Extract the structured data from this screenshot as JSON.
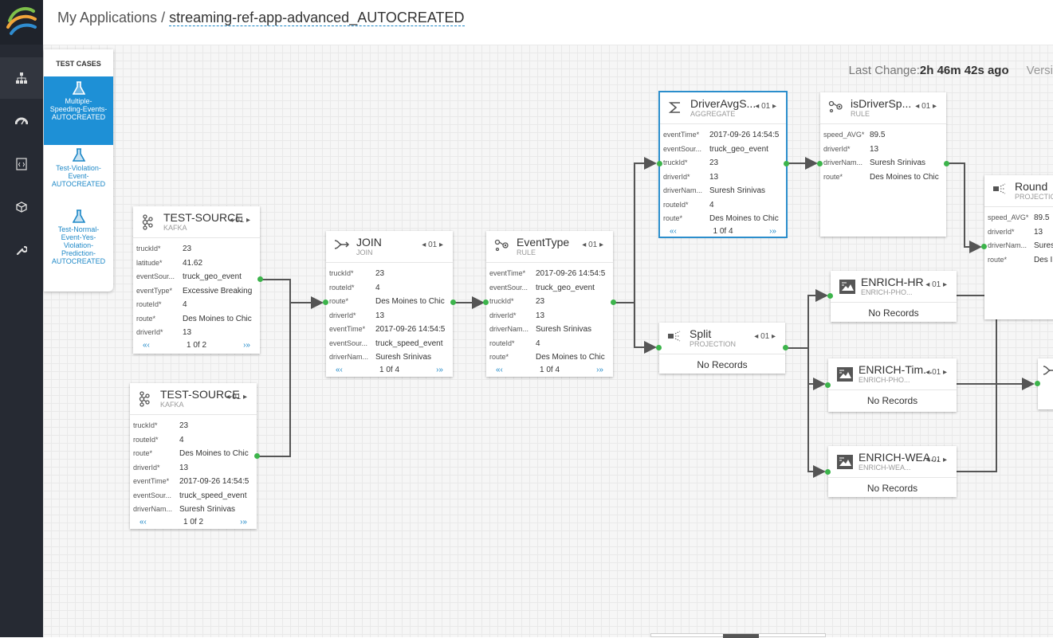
{
  "breadcrumb": {
    "root": "My Applications",
    "separator": " / ",
    "app": "streaming-ref-app-advanced_AUTOCREATED"
  },
  "status": {
    "label": "Last Change:",
    "value": "2h 46m 42s ago",
    "version": "Versi"
  },
  "testcases": {
    "title": "TEST CASES",
    "items": [
      {
        "label": "Multiple-Speeding-Events-AUTOCREATED",
        "lines": [
          "Multiple-",
          "Speeding-Events-",
          "AUTOCREATED"
        ],
        "active": true
      },
      {
        "label": "Test-Violation-Event-AUTOCREATED",
        "lines": [
          "Test-Violation-",
          "Event-",
          "AUTOCREATED"
        ],
        "active": false
      },
      {
        "label": "Test-Normal-Event-Yes-Violation-Prediction-AUTOCREATED",
        "lines": [
          "Test-Normal-",
          "Event-Yes-",
          "Violation-",
          "Prediction-",
          "AUTOCREATED"
        ],
        "active": false
      }
    ]
  },
  "nodes": {
    "source1": {
      "title": "TEST-SOURCE",
      "sub": "KAFKA",
      "idx": "01",
      "icon": "kafka-icon",
      "rows": [
        [
          "truckId*",
          "23"
        ],
        [
          "latitude*",
          "41.62"
        ],
        [
          "eventSour...",
          "truck_geo_event"
        ],
        [
          "eventType*",
          "Excessive Breaking"
        ],
        [
          "routeId*",
          "4"
        ],
        [
          "route*",
          "Des Moines to Chic"
        ],
        [
          "driverId*",
          "13"
        ]
      ],
      "page": "1 0f 2"
    },
    "source2": {
      "title": "TEST-SOURCE",
      "sub": "KAFKA",
      "idx": "01",
      "icon": "kafka-icon",
      "rows": [
        [
          "truckId*",
          "23"
        ],
        [
          "routeId*",
          "4"
        ],
        [
          "route*",
          "Des Moines to Chic"
        ],
        [
          "driverId*",
          "13"
        ],
        [
          "eventTime*",
          "2017-09-26 14:54:5"
        ],
        [
          "eventSour...",
          "truck_speed_event"
        ],
        [
          "driverNam...",
          "Suresh Srinivas"
        ]
      ],
      "page": "1 0f 2"
    },
    "join": {
      "title": "JOIN",
      "sub": "JOIN",
      "idx": "01",
      "icon": "join-icon",
      "rows": [
        [
          "truckId*",
          "23"
        ],
        [
          "routeId*",
          "4"
        ],
        [
          "route*",
          "Des Moines to Chic"
        ],
        [
          "driverId*",
          "13"
        ],
        [
          "eventTime*",
          "2017-09-26 14:54:5"
        ],
        [
          "eventSour...",
          "truck_speed_event"
        ],
        [
          "driverNam...",
          "Suresh Srinivas"
        ]
      ],
      "page": "1 0f 4"
    },
    "eventtype": {
      "title": "EventType",
      "sub": "RULE",
      "idx": "01",
      "icon": "rule-icon",
      "rows": [
        [
          "eventTime*",
          "2017-09-26 14:54:5"
        ],
        [
          "eventSour...",
          "truck_geo_event"
        ],
        [
          "truckId*",
          "23"
        ],
        [
          "driverId*",
          "13"
        ],
        [
          "driverNam...",
          "Suresh Srinivas"
        ],
        [
          "routeId*",
          "4"
        ],
        [
          "route*",
          "Des Moines to Chic"
        ]
      ],
      "page": "1 0f 4"
    },
    "aggregate": {
      "title": "DriverAvgS...",
      "sub": "AGGREGATE",
      "idx": "01",
      "icon": "sigma-icon",
      "rows": [
        [
          "eventTime*",
          "2017-09-26 14:54:5"
        ],
        [
          "eventSour...",
          "truck_geo_event"
        ],
        [
          "truckId*",
          "23"
        ],
        [
          "driverId*",
          "13"
        ],
        [
          "driverNam...",
          "Suresh Srinivas"
        ],
        [
          "routeId*",
          "4"
        ],
        [
          "route*",
          "Des Moines to Chic"
        ]
      ],
      "page": "1 0f 4"
    },
    "isdriver": {
      "title": "isDriverSp...",
      "sub": "RULE",
      "idx": "01",
      "icon": "rule-icon",
      "rows": [
        [
          "speed_AVG*",
          "89.5"
        ],
        [
          "driverId*",
          "13"
        ],
        [
          "driverNam...",
          "Suresh Srinivas"
        ],
        [
          "route*",
          "Des Moines to Chic"
        ]
      ]
    },
    "round": {
      "title": "Round",
      "sub": "PROJECTIO",
      "icon": "projection-icon",
      "rows": [
        [
          "speed_AVG*",
          "89.5"
        ],
        [
          "driverId*",
          "13"
        ],
        [
          "driverNam...",
          "Sures"
        ],
        [
          "route*",
          "Des I"
        ]
      ]
    },
    "split": {
      "title": "Split",
      "sub": "PROJECTION",
      "idx": "01",
      "icon": "projection-icon",
      "norec": "No Records"
    },
    "enrich_hr": {
      "title": "ENRICH-HR",
      "sub": "ENRICH-PHO...",
      "idx": "01",
      "icon": "enrich-icon",
      "norec": "No Records"
    },
    "enrich_tim": {
      "title": "ENRICH-Tim...",
      "sub": "ENRICH-PHO...",
      "idx": "01",
      "icon": "enrich-icon",
      "norec": "No Records"
    },
    "enrich_wea": {
      "title": "ENRICH-WEA...",
      "sub": "ENRICH-WEA...",
      "idx": "01",
      "icon": "enrich-icon",
      "norec": "No Records"
    }
  },
  "sidebar": {
    "items": [
      "topology-icon",
      "dashboard-icon",
      "code-icon",
      "package-icon",
      "wrench-icon"
    ]
  }
}
